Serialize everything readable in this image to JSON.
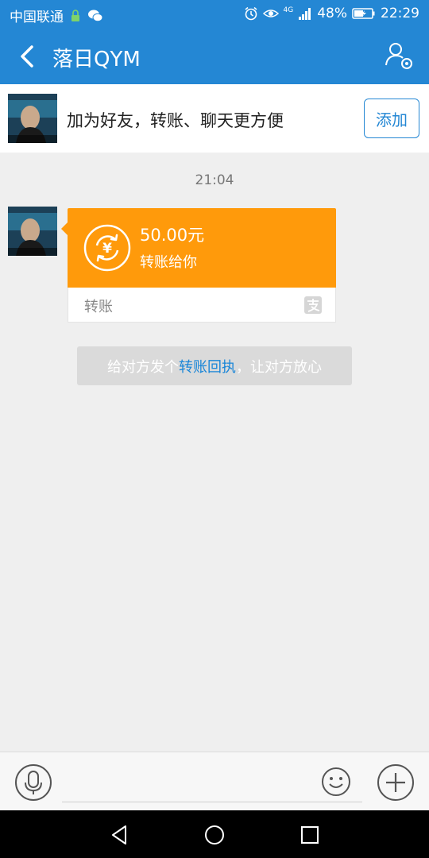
{
  "status_bar": {
    "carrier": "中国联通",
    "network": "4G",
    "battery": "48%",
    "time": "22:29"
  },
  "header": {
    "title": "落日QYM"
  },
  "friend_banner": {
    "text": "加为好友，转账、聊天更方便",
    "add_label": "添加"
  },
  "chat": {
    "timestamp": "21:04",
    "transfer_card": {
      "amount": "50.00元",
      "description": "转账给你",
      "type_label": "转账"
    },
    "notice": {
      "prefix": "给对方发个",
      "link": "转账回执",
      "suffix": "，让对方放心"
    }
  },
  "colors": {
    "accent": "#2487d4",
    "transfer_orange": "#ff9a0b",
    "background": "#efefef"
  },
  "icons": [
    "back-arrow-icon",
    "user-settings-icon",
    "yen-transfer-icon",
    "alipay-icon",
    "microphone-icon",
    "emoji-icon",
    "plus-icon",
    "nav-back-icon",
    "nav-home-icon",
    "nav-recent-icon"
  ]
}
